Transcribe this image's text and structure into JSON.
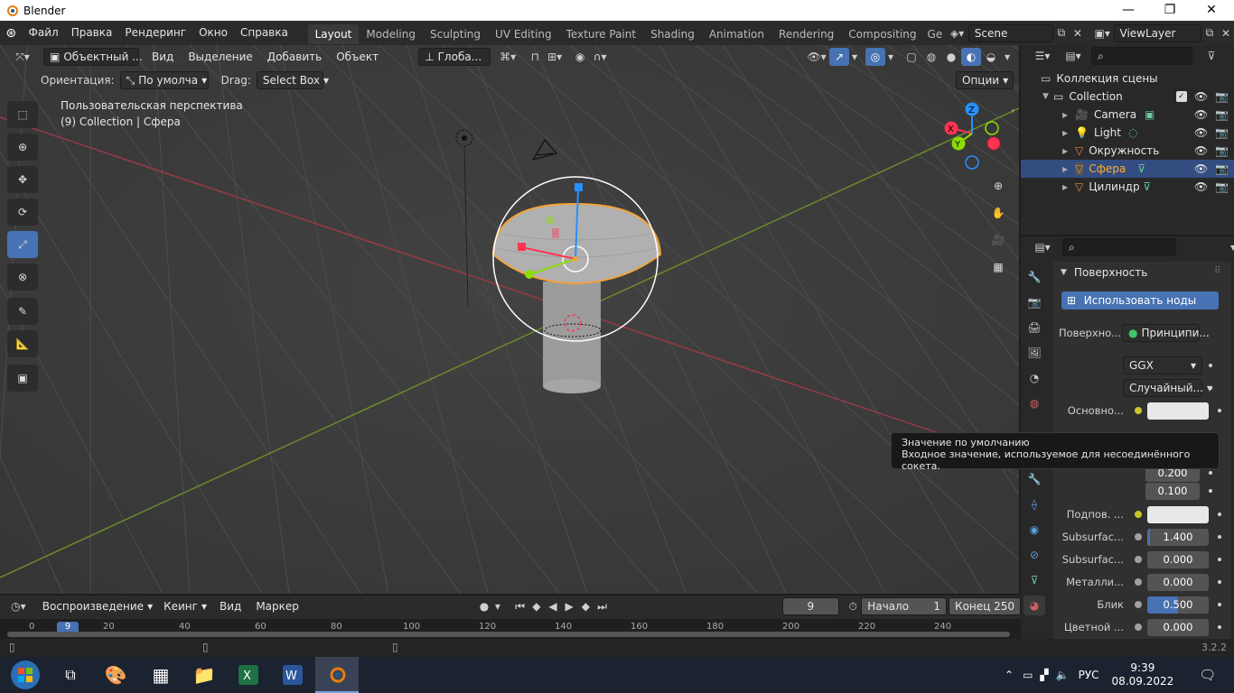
{
  "window": {
    "title": "Blender"
  },
  "menus": [
    "Файл",
    "Правка",
    "Рендеринг",
    "Окно",
    "Справка"
  ],
  "workspaces": [
    "Layout",
    "Modeling",
    "Sculpting",
    "UV Editing",
    "Texture Paint",
    "Shading",
    "Animation",
    "Rendering",
    "Compositing",
    "Ge"
  ],
  "active_workspace": "Layout",
  "scene": "Scene",
  "view_layer": "ViewLayer",
  "viewport_header": {
    "mode": "Объектный ...",
    "menus": [
      "Вид",
      "Выделение",
      "Добавить",
      "Объект"
    ],
    "transform_orientation": "Глоба..."
  },
  "tool_header": {
    "orientation_label": "Ориентация:",
    "orientation_value": "По умолча",
    "drag_label": "Drag:",
    "drag_value": "Select Box",
    "options": "Опции"
  },
  "viewport": {
    "view_name": "Пользовательская перспектива",
    "collection_info": "(9) Collection | Сфера",
    "gizmo_axes": [
      "X",
      "Y",
      "Z"
    ]
  },
  "outliner": {
    "root": "Коллекция сцены",
    "collection": "Collection",
    "items": [
      {
        "name": "Camera",
        "color": "#e0aa6a"
      },
      {
        "name": "Light",
        "color": "#e0aa6a"
      },
      {
        "name": "Окружность",
        "color": "#e08a4a"
      },
      {
        "name": "Сфера",
        "color": "#e08a4a",
        "selected": true
      },
      {
        "name": "Цилиндр",
        "color": "#e08a4a"
      }
    ]
  },
  "properties": {
    "panel_title": "Поверхность",
    "use_nodes": "Использовать ноды",
    "surface_label": "Поверхно...",
    "surface_value": "Принципи...",
    "distribution": "GGX",
    "subsurface_method": "Случайный...",
    "rows": [
      {
        "label": "Основно...",
        "dot": "yellow",
        "type": "color",
        "value": ""
      },
      {
        "label": "",
        "dot": "",
        "type": "number",
        "value": "0.200"
      },
      {
        "label": "",
        "dot": "",
        "type": "number",
        "value": "0.100"
      },
      {
        "label": "Подпов. ...",
        "dot": "yellow",
        "type": "color",
        "value": ""
      },
      {
        "label": "Subsurfac...",
        "dot": "gray",
        "type": "number",
        "value": "1.400",
        "fill": 0.05
      },
      {
        "label": "Subsurfac...",
        "dot": "gray",
        "type": "number",
        "value": "0.000",
        "fill": 0
      },
      {
        "label": "Металли...",
        "dot": "gray",
        "type": "number",
        "value": "0.000",
        "fill": 0
      },
      {
        "label": "Блик",
        "dot": "gray",
        "type": "number",
        "value": "0.500",
        "fill": 0.5
      },
      {
        "label": "Цветной ...",
        "dot": "gray",
        "type": "number",
        "value": "0.000",
        "fill": 0
      }
    ]
  },
  "tooltip": {
    "title": "Значение по умолчанию",
    "description": "Входное значение, используемое для несоединённого сокета."
  },
  "timeline": {
    "menus": [
      "Воспроизведение",
      "Кеинг",
      "Вид",
      "Маркер"
    ],
    "current_frame": "9",
    "start_label": "Начало",
    "start_value": "1",
    "end_label": "Конец",
    "end_value": "250",
    "ruler": [
      "0",
      "9",
      "20",
      "40",
      "60",
      "80",
      "100",
      "120",
      "140",
      "160",
      "180",
      "200",
      "220",
      "240"
    ]
  },
  "status": {
    "version": "3.2.2"
  },
  "taskbar": {
    "language": "РУС",
    "time": "9:39",
    "date": "08.09.2022"
  },
  "colors": {
    "accent": "#4772b3",
    "selection_orange": "#f2a33a",
    "axis_x": "#ff3352",
    "axis_y": "#8bdc00",
    "axis_z": "#2890ff"
  }
}
